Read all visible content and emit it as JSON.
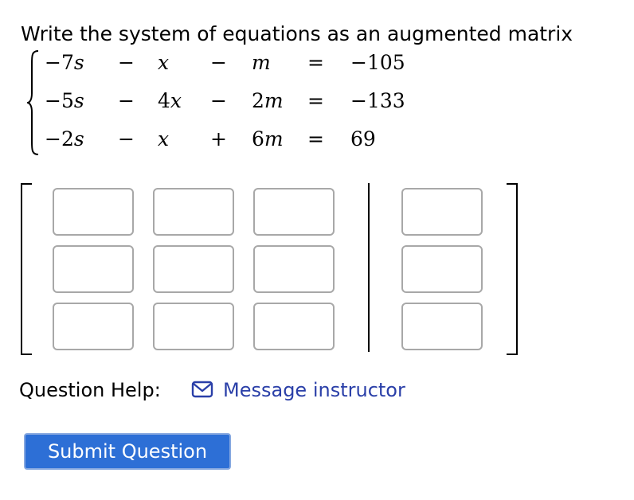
{
  "prompt": "Write the system of equations as an augmented matrix",
  "system": {
    "rows": [
      {
        "t1": "−7",
        "v1": "s",
        "op1": "−",
        "t2": "",
        "v2": "x",
        "op2": "−",
        "t3": "",
        "v3": "m",
        "eq": "=",
        "rhs": "−105"
      },
      {
        "t1": "−5",
        "v1": "s",
        "op1": "−",
        "t2": "4",
        "v2": "x",
        "op2": "−",
        "t3": "2",
        "v3": "m",
        "eq": "=",
        "rhs": "−133"
      },
      {
        "t1": "−2",
        "v1": "s",
        "op1": "−",
        "t2": "",
        "v2": "x",
        "op2": "+",
        "t3": "6",
        "v3": "m",
        "eq": "=",
        "rhs": "69"
      }
    ]
  },
  "matrix": {
    "rows": 3,
    "coefficient_columns": 3,
    "augmented_columns": 1,
    "values": [
      [
        "",
        "",
        "",
        ""
      ],
      [
        "",
        "",
        "",
        ""
      ],
      [
        "",
        "",
        "",
        ""
      ]
    ]
  },
  "help": {
    "label": "Question Help:",
    "icon": "envelope-icon",
    "link_label": "Message instructor",
    "link_color": "#2a3fa8"
  },
  "submit": {
    "label": "Submit Question",
    "color": "#2d6fd6"
  }
}
